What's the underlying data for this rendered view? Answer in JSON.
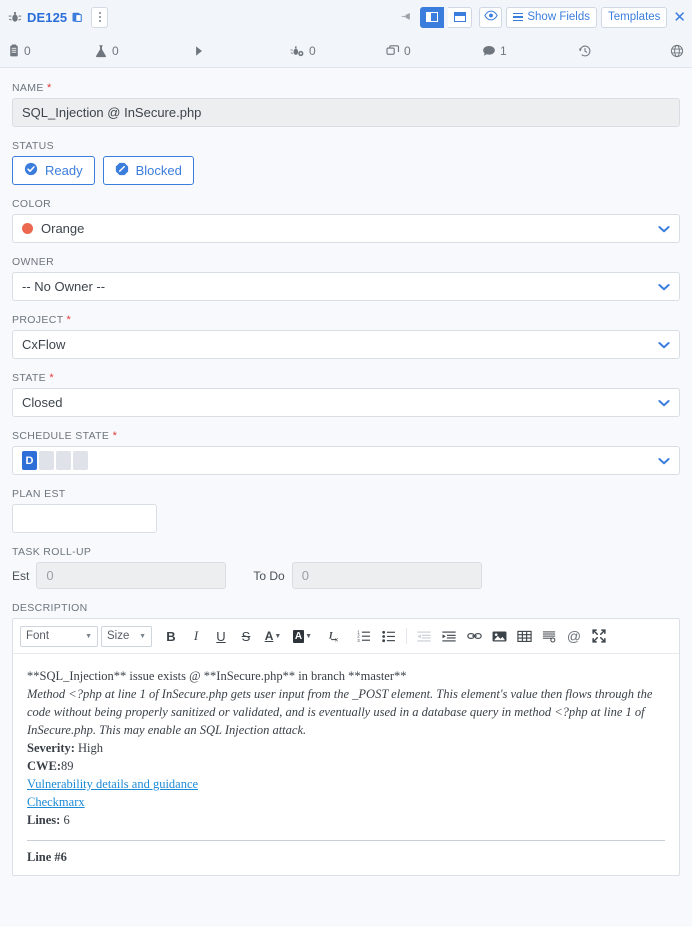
{
  "header": {
    "bug_icon": "bug-icon",
    "id": "DE125",
    "copy_icon": "copy-icon",
    "kebab_label": "more-actions",
    "pin_icon": "pin-icon",
    "layout_left_icon": "layout-sidebar-icon",
    "layout_full_icon": "layout-full-icon",
    "eye_icon": "eye-icon",
    "show_fields_label": "Show Fields",
    "templates_label": "Templates",
    "close_label": "✕",
    "accent": "#3b7ddd"
  },
  "stats": [
    {
      "icon": "task-icon",
      "value": "0"
    },
    {
      "icon": "flask-icon",
      "value": "0"
    },
    {
      "icon": "play-icon",
      "value": ""
    },
    {
      "icon": "defect-suite-icon",
      "value": "0"
    },
    {
      "icon": "copies-icon",
      "value": "0"
    },
    {
      "icon": "discussion-icon",
      "value": "1"
    },
    {
      "icon": "history-icon",
      "value": ""
    },
    {
      "icon": "globe-icon",
      "value": ""
    }
  ],
  "fields": {
    "name": {
      "label": "NAME",
      "required": true,
      "value": "SQL_Injection @ InSecure.php"
    },
    "status": {
      "label": "STATUS",
      "buttons": [
        {
          "label": "Ready",
          "icon": "check-circle-icon"
        },
        {
          "label": "Blocked",
          "icon": "blocked-octagon-icon"
        }
      ]
    },
    "color": {
      "label": "COLOR",
      "required": false,
      "value": "Orange",
      "swatch": "#ec6851"
    },
    "owner": {
      "label": "OWNER",
      "required": false,
      "value": "-- No Owner --"
    },
    "project": {
      "label": "PROJECT",
      "required": true,
      "value": "CxFlow"
    },
    "state": {
      "label": "STATE",
      "required": true,
      "value": "Closed"
    },
    "schedule_state": {
      "label": "SCHEDULE STATE",
      "required": true,
      "active_letter": "D",
      "segments": 4,
      "active_index": 0
    },
    "plan_est": {
      "label": "PLAN EST",
      "value": ""
    },
    "task_rollup": {
      "label": "TASK ROLL-UP",
      "est_label": "Est",
      "est_value": "0",
      "todo_label": "To Do",
      "todo_value": "0"
    }
  },
  "description": {
    "label": "DESCRIPTION",
    "toolbar": {
      "font_label": "Font",
      "size_label": "Size",
      "bold": "B",
      "italic": "I",
      "underline": "U",
      "strike": "S",
      "text_color": "A",
      "bg_color": "A",
      "remove_format_icon": "clear-format-icon",
      "ordered_list_icon": "numbered-list-icon",
      "bullet_list_icon": "bullet-list-icon",
      "outdent_icon": "outdent-icon",
      "indent_icon": "indent-icon",
      "link_icon": "link-icon",
      "image_icon": "image-icon",
      "table_icon": "table-icon",
      "page_break_icon": "page-break-icon",
      "mention_icon": "mention-icon",
      "fullscreen_icon": "fullscreen-icon"
    },
    "body": {
      "line1": "**SQL_Injection** issue exists @ **InSecure.php** in branch **master**",
      "para": "Method <?php at line 1 of InSecure.php gets user input from the _POST element. This element's value then flows through the code without being properly sanitized or validated, and is eventually used in a database query in method <?php at line 1 of InSecure.php. This may enable an SQL Injection attack.",
      "severity_label": "Severity:",
      "severity_value": "High",
      "cwe_label": "CWE:",
      "cwe_value": "89",
      "link1": "Vulnerability details and guidance",
      "link2": "Checkmarx",
      "lines_label": "Lines:",
      "lines_value": "6",
      "line_ref": "Line #6"
    }
  }
}
